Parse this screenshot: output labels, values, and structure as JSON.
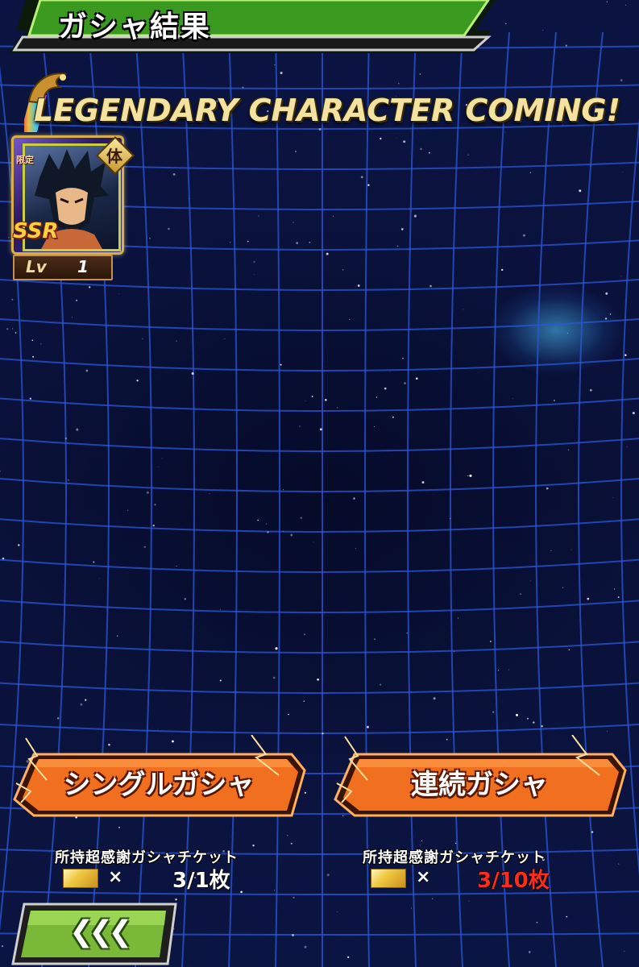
{
  "header": {
    "title": "ガシャ結果"
  },
  "banner": {
    "text": "LEGENDARY CHARACTER COMING!"
  },
  "card": {
    "limited_label": "限定",
    "type_label": "体",
    "rarity": "SSR",
    "level_label": "Lv",
    "level_value": "1"
  },
  "single_gacha": {
    "label": "シングルガシャ",
    "ticket_label": "所持超感謝ガシャチケット",
    "times_symbol": "×",
    "count": "3/1枚",
    "count_color": "#ffffff"
  },
  "multi_gacha": {
    "label": "連続ガシャ",
    "ticket_label": "所持超感謝ガシャチケット",
    "times_symbol": "×",
    "count": "3/10枚",
    "count_color": "#ff2a20"
  },
  "back_button": {
    "label": "❮❮❮"
  },
  "colors": {
    "header_green": "#3a9a20",
    "button_orange": "#f07020",
    "back_green": "#7ab838",
    "grid_blue": "#2a58d8"
  }
}
